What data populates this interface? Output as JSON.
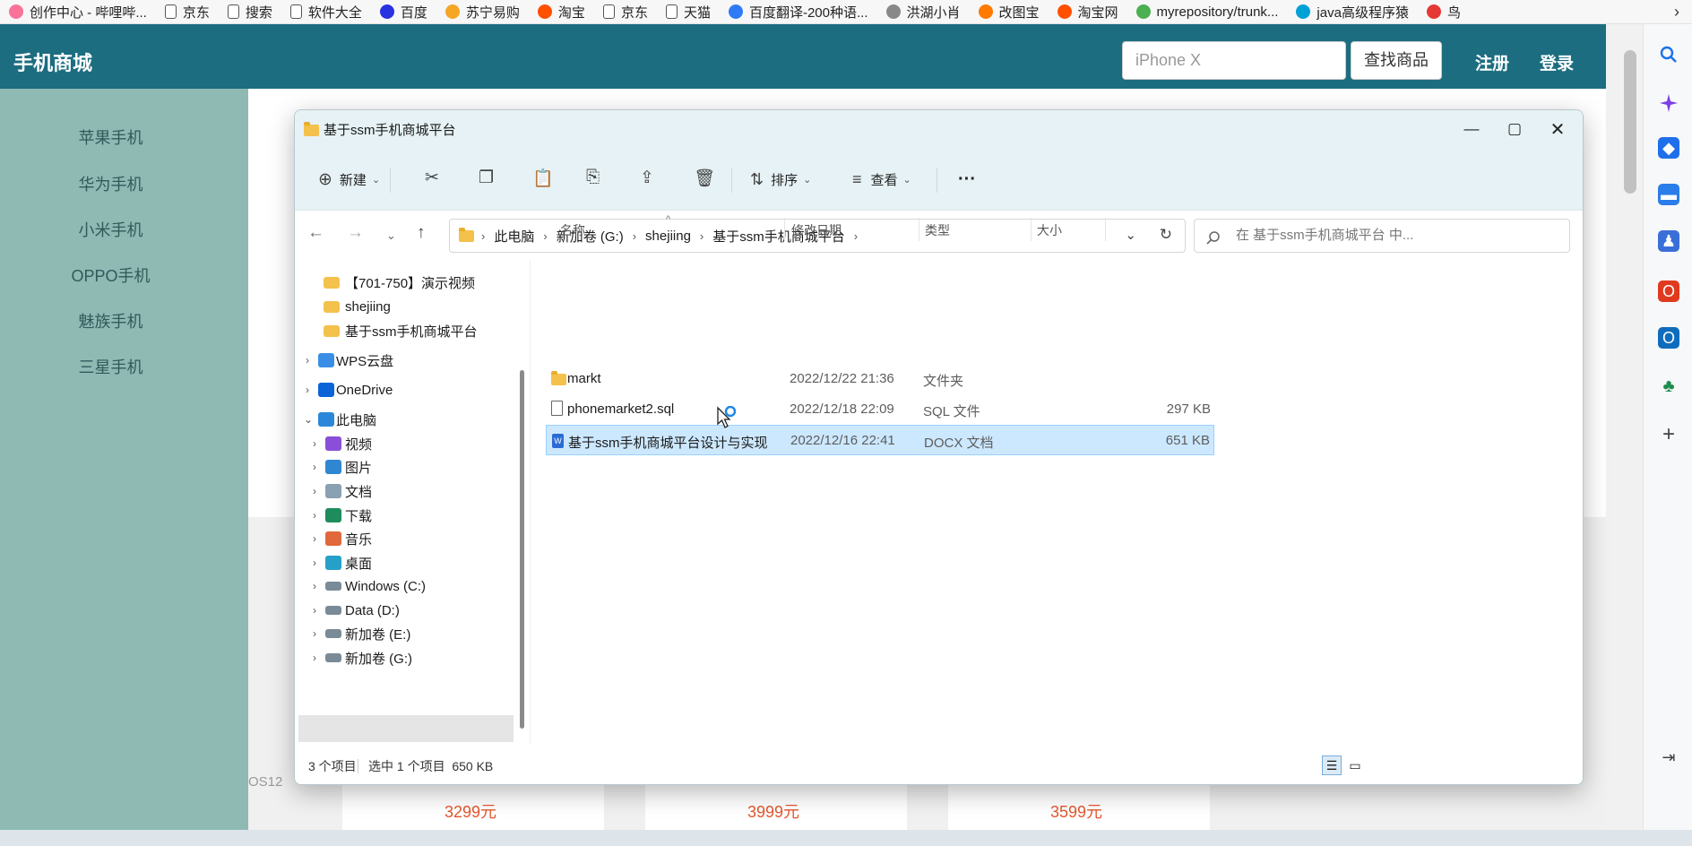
{
  "browser": {
    "bookmarks": [
      {
        "label": "创作中心 - 哔哩哔...",
        "icon": "bilibili-icon",
        "color": "#fb7299"
      },
      {
        "label": "京东",
        "icon": "page-icon"
      },
      {
        "label": "搜索",
        "icon": "page-icon"
      },
      {
        "label": "软件大全",
        "icon": "page-icon"
      },
      {
        "label": "百度",
        "icon": "baidu-icon",
        "color": "#2932e1"
      },
      {
        "label": "苏宁易购",
        "icon": "suning-icon",
        "color": "#f5a623"
      },
      {
        "label": "淘宝",
        "icon": "taobao-icon",
        "color": "#ff5000"
      },
      {
        "label": "京东",
        "icon": "page-icon"
      },
      {
        "label": "天猫",
        "icon": "page-icon"
      },
      {
        "label": "百度翻译-200种语...",
        "icon": "translate-icon",
        "color": "#2f7bf5"
      },
      {
        "label": "洪湖小肖",
        "icon": "bookmark-icon",
        "color": "#888888"
      },
      {
        "label": "改图宝",
        "icon": "gaitubao-icon",
        "color": "#ff7a00"
      },
      {
        "label": "淘宝网",
        "icon": "taobao-icon",
        "color": "#ff5000"
      },
      {
        "label": "myrepository/trunk...",
        "icon": "chrome-icon",
        "color": "#4caf50"
      },
      {
        "label": "java高级程序猿",
        "icon": "bilibili-tv-icon",
        "color": "#00a1d6"
      },
      {
        "label": "鸟",
        "icon": "bird-icon",
        "color": "#e53935"
      }
    ]
  },
  "site": {
    "title": "手机商城",
    "search_placeholder": "iPhone X",
    "find_button": "查找商品",
    "register": "注册",
    "login": "登录",
    "categories": [
      "苹果手机",
      "华为手机",
      "小米手机",
      "OPPO手机",
      "魅族手机",
      "三星手机"
    ],
    "ios_fragment": "OS12",
    "prices": [
      "3299元",
      "3999元",
      "3599元"
    ]
  },
  "explorer": {
    "window_title": "基于ssm手机商城平台",
    "toolbar": {
      "new": "新建",
      "sort": "排序",
      "view": "查看",
      "more": "···"
    },
    "address": [
      "此电脑",
      "新加卷 (G:)",
      "shejiing",
      "基于ssm手机商城平台"
    ],
    "search_placeholder": "在 基于ssm手机商城平台 中...",
    "nav_tree": [
      {
        "label": "【701-750】演示视频",
        "icon": "folder-icon"
      },
      {
        "label": "shejiing",
        "icon": "folder-icon"
      },
      {
        "label": "基于ssm手机商城平台",
        "icon": "folder-icon"
      },
      {
        "label": "WPS云盘",
        "icon": "cloud-icon"
      },
      {
        "label": "OneDrive",
        "icon": "onedrive-icon"
      },
      {
        "label": "此电脑",
        "icon": "pc-icon"
      },
      {
        "label": "视频",
        "icon": "video-icon"
      },
      {
        "label": "图片",
        "icon": "pictures-icon"
      },
      {
        "label": "文档",
        "icon": "documents-icon"
      },
      {
        "label": "下载",
        "icon": "download-icon"
      },
      {
        "label": "音乐",
        "icon": "music-icon"
      },
      {
        "label": "桌面",
        "icon": "desktop-icon"
      },
      {
        "label": "Windows (C:)",
        "icon": "drive-icon"
      },
      {
        "label": "Data (D:)",
        "icon": "drive-icon"
      },
      {
        "label": "新加卷 (E:)",
        "icon": "drive-icon"
      },
      {
        "label": "新加卷 (G:)",
        "icon": "drive-icon"
      }
    ],
    "columns": {
      "name": "名称",
      "date": "修改日期",
      "type": "类型",
      "size": "大小"
    },
    "files": [
      {
        "name": "markt",
        "date": "2022/12/22 21:36",
        "type": "文件夹",
        "size": "",
        "icon": "folder-icon"
      },
      {
        "name": "phonemarket2.sql",
        "date": "2022/12/18 22:09",
        "type": "SQL 文件",
        "size": "297 KB",
        "icon": "file-icon"
      },
      {
        "name": "基于ssm手机商城平台设计与实现",
        "date": "2022/12/16 22:41",
        "type": "DOCX 文档",
        "size": "651 KB",
        "icon": "word-doc-icon"
      }
    ],
    "status": {
      "count": "3 个项目",
      "selection": "选中 1 个项目  650 KB"
    }
  },
  "colors": {
    "header": "#1c6d80",
    "sidebar": "#8fb9b3",
    "selection": "#cce8ff",
    "price": "#e4572e"
  }
}
